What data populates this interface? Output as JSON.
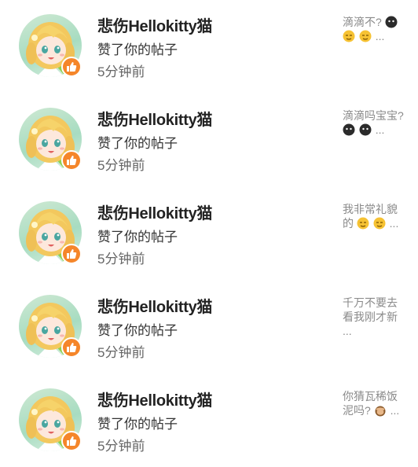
{
  "notifications": [
    {
      "name": "悲伤Hellokitty猫",
      "action": "赞了你的帖子",
      "time": "5分钟前",
      "preview_text": "滴滴不?",
      "preview_emoji": [
        "dark-face",
        "yellow-face",
        "yellow-face"
      ],
      "preview_ellipsis": "..."
    },
    {
      "name": "悲伤Hellokitty猫",
      "action": "赞了你的帖子",
      "time": "5分钟前",
      "preview_text": "滴滴吗宝宝?",
      "preview_emoji": [
        "dark-face",
        "dark-face"
      ],
      "preview_ellipsis": "..."
    },
    {
      "name": "悲伤Hellokitty猫",
      "action": "赞了你的帖子",
      "time": "5分钟前",
      "preview_text": "我非常礼貌的",
      "preview_emoji": [
        "yellow-face",
        "yellow-face"
      ],
      "preview_ellipsis": "..."
    },
    {
      "name": "悲伤Hellokitty猫",
      "action": "赞了你的帖子",
      "time": "5分钟前",
      "preview_text": "千万不要去看我刚才新",
      "preview_emoji": [],
      "preview_ellipsis": "..."
    },
    {
      "name": "悲伤Hellokitty猫",
      "action": "赞了你的帖子",
      "time": "5分钟前",
      "preview_text": "你猜瓦稀饭泥吗?",
      "preview_emoji": [
        "monkey-face"
      ],
      "preview_ellipsis": "..."
    }
  ],
  "badge_icon": "thumbs-up-icon",
  "colors": {
    "badge": "#f5862a",
    "name": "#222222",
    "preview": "#8a8a8a"
  }
}
